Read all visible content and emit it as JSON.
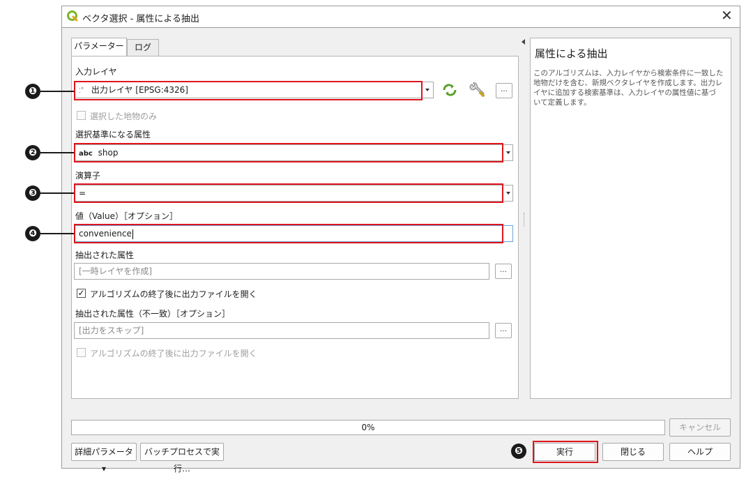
{
  "window": {
    "title": "ベクタ選択 - 属性による抽出",
    "close_glyph": "✕"
  },
  "tabs": [
    {
      "label": "パラメーター"
    },
    {
      "label": "ログ"
    }
  ],
  "params": {
    "input_layer": {
      "label": "入力レイヤ",
      "value": "出力レイヤ [EPSG:4326]",
      "icon": "point-layer-icon"
    },
    "selected_only": {
      "label": "選択した地物のみ",
      "checked": false
    },
    "attribute": {
      "label": "選択基準になる属性",
      "type_prefix": "abc",
      "value": "shop"
    },
    "operator": {
      "label": "演算子",
      "value": "="
    },
    "value": {
      "label": "値（Value）［オプション］",
      "value": "convenience"
    },
    "extracted": {
      "label": "抽出された属性",
      "placeholder": "[一時レイヤを作成]"
    },
    "open_after_1": {
      "label": "アルゴリズムの終了後に出力ファイルを開く",
      "checked": true
    },
    "extracted_nonmatch": {
      "label": "抽出された属性（不一致）［オプション］",
      "placeholder": "[出力をスキップ]"
    },
    "open_after_2": {
      "label": "アルゴリズムの終了後に出力ファイルを開く",
      "checked": false
    },
    "more_button": "…"
  },
  "help": {
    "title": "属性による抽出",
    "body_lines": [
      "このアルゴリズムは、入力レイヤから検索条件に一致した",
      "地物だけを含む、新規ベクタレイヤを作成します。出力レ",
      "イヤに追加する検索基準は、入力レイヤの属性値に基づ",
      "いて定義します。"
    ]
  },
  "progress": {
    "text": "0%",
    "value": 0
  },
  "buttons": {
    "cancel": "キャンセル",
    "advanced": "詳細パラメータ ▾",
    "batch": "バッチプロセスで実行…",
    "run": "実行",
    "close": "閉じる",
    "help": "ヘルプ"
  },
  "markers": [
    "❶",
    "❷",
    "❸",
    "❹",
    "❺"
  ],
  "colors": {
    "annotation_red": "#e0141b",
    "qgis_green": "#7bb52c"
  }
}
